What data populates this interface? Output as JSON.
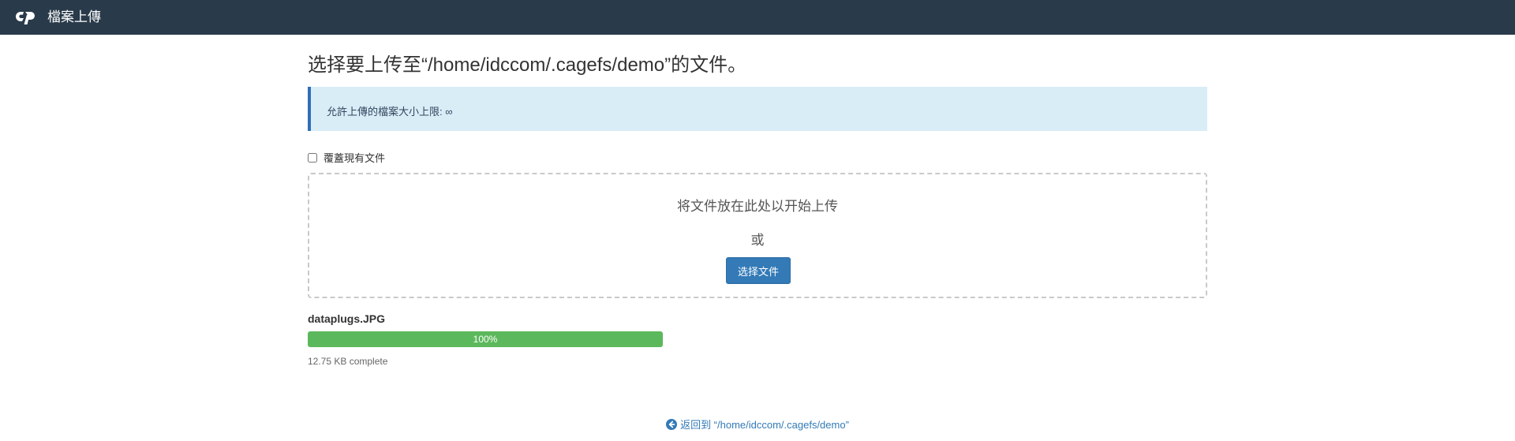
{
  "header": {
    "logo_icon": "cpanel-logo-icon",
    "title": "檔案上傳"
  },
  "main": {
    "page_title": "选择要上传至“/home/idccom/.cagefs/demo”的文件。",
    "alert_text": "允許上傳的檔案大小上限: ∞",
    "overwrite_label": "覆蓋現有文件",
    "overwrite_checked": false,
    "dropzone": {
      "drop_text": "将文件放在此处以开始上传",
      "or_text": "或",
      "select_button": "选择文件"
    },
    "upload": {
      "file_name": "dataplugs.JPG",
      "progress_percent": 100,
      "progress_label": "100%",
      "status_text": "12.75 KB complete"
    },
    "back_link": {
      "icon": "arrow-circle-left-icon",
      "label": "返回到 “/home/idccom/.cagefs/demo”"
    }
  },
  "colors": {
    "topbar": "#293a4a",
    "alert_bg": "#d9edf7",
    "alert_border": "#2f6fb7",
    "primary": "#337ab7",
    "success": "#5cb85c"
  }
}
